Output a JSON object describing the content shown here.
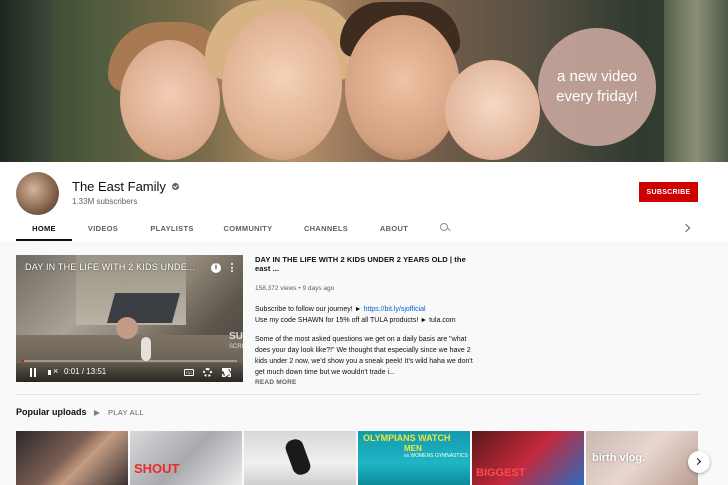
{
  "banner": {
    "tagline": "a new video every friday!"
  },
  "channel": {
    "name": "The East Family",
    "subscribers": "1.33M subscribers",
    "subscribe_label": "SUBSCRIBE"
  },
  "tabs": [
    {
      "label": "HOME"
    },
    {
      "label": "VIDEOS"
    },
    {
      "label": "PLAYLISTS"
    },
    {
      "label": "COMMUNITY"
    },
    {
      "label": "CHANNELS"
    },
    {
      "label": "ABOUT"
    }
  ],
  "featured": {
    "player_title": "DAY IN THE LIFE WITH 2 KIDS UNDE...",
    "watermark": "SUB",
    "watermark_small": "SCRIB",
    "time": "0:01 / 13:51",
    "progress": 0.01,
    "title": "DAY IN THE LIFE WITH 2 KIDS UNDER 2 YEARS OLD | the east ...",
    "meta": "158,372 views • 9 days ago",
    "desc_line1_prefix": "Subscribe to follow our journey! ► ",
    "desc_link": "https://bit.ly/sjofficial",
    "desc_line2": "Use my code SHAWN for 15% off all TULA products! ► tula.com",
    "desc_para2": "Some of the most asked questions we get on a daily basis are \"what does your day look like?!\" We thought that especially since we have 2 kids under 2 now, we'd show you a sneak peek! It's wild haha we don't get much down time but we wouldn't trade i...",
    "read_more": "READ MORE"
  },
  "shelf": {
    "title": "Popular uploads",
    "play_all": "PLAY ALL",
    "thumb2_text": "SHOUT",
    "thumb4_text1": "OLYMPIANS WATCH",
    "thumb4_text2": "MEN",
    "thumb4_text3": "vs WOMENS GYMNASTICS",
    "thumb5_text": "BIGGEST",
    "thumb6_text": "birth vlog."
  },
  "colors": {
    "subscribe": "#cc0000",
    "link": "#065fd4",
    "progress": "#ff0000"
  }
}
